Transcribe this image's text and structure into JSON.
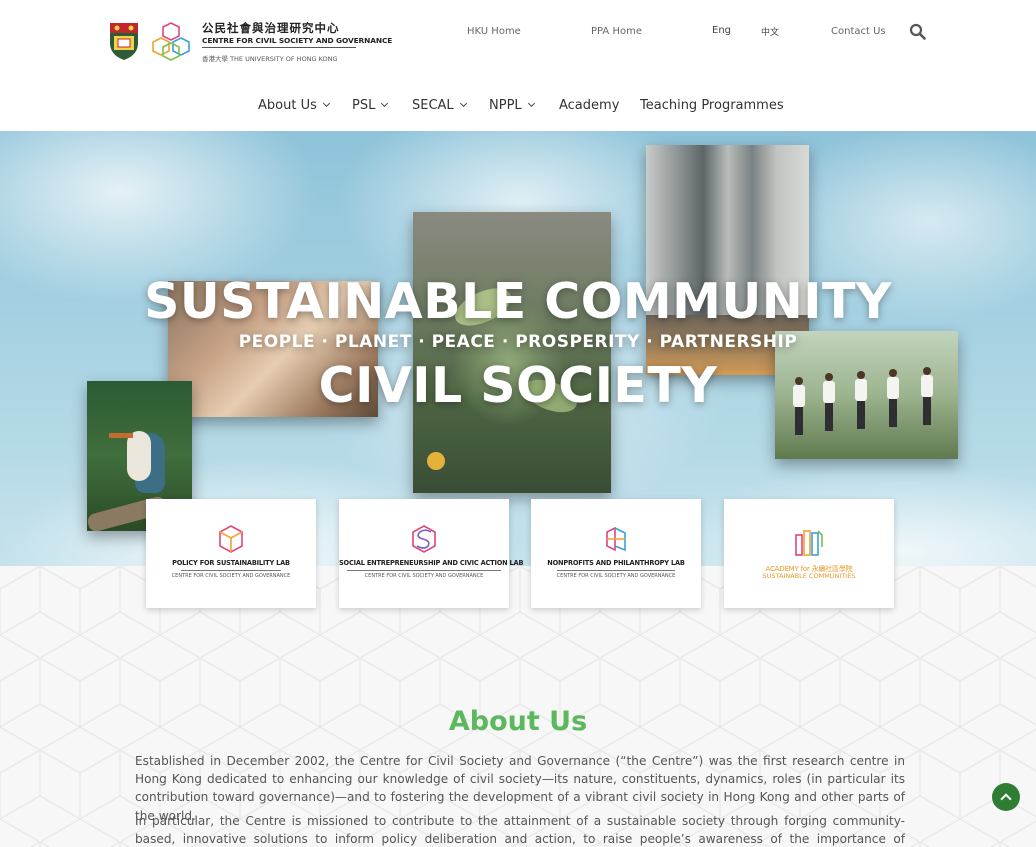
{
  "header": {
    "logo": {
      "name_cn": "公民社會與治理研究中心",
      "name_en": "CENTRE FOR CIVIL SOCIETY AND GOVERNANCE",
      "university": "香港大學 THE UNIVERSITY OF HONG KONG"
    },
    "top_links": {
      "hku_home": "HKU Home",
      "ppa_home": "PPA Home",
      "eng": "Eng",
      "chinese": "中文",
      "contact": "Contact Us"
    },
    "nav": {
      "about": "About Us",
      "psl": "PSL",
      "secal": "SECAL",
      "nppl": "NPPL",
      "academy": "Academy",
      "teaching": "Teaching Programmes"
    }
  },
  "hero": {
    "line1": "SUSTAINABLE COMMUNITY",
    "line2": "PEOPLE · PLANET · PEACE · PROSPERITY · PARTNERSHIP",
    "line3": "CIVIL SOCIETY"
  },
  "labs": [
    {
      "name": "POLICY FOR SUSTAINABILITY LAB",
      "sub": "CENTRE FOR CIVIL SOCIETY AND GOVERNANCE"
    },
    {
      "name": "SOCIAL ENTREPRENEURSHIP AND CIVIC ACTION LAB",
      "sub": "CENTRE FOR CIVIL SOCIETY AND GOVERNANCE"
    },
    {
      "name": "NONPROFITS AND PHILANTHROPY LAB",
      "sub": "CENTRE FOR CIVIL SOCIETY AND GOVERNANCE"
    },
    {
      "name": "ACADEMY for 永續社區學院",
      "sub": "SUSTAINABLE COMMUNITIES"
    }
  ],
  "about": {
    "title": "About Us",
    "p1": "Established in December 2002, the Centre for Civil Society and Governance (“the Centre”) was the first research centre in Hong Kong dedicated to enhancing our knowledge of civil society—its nature, constituents, dynamics, roles (in particular its contribution toward governance)—and to fostering the development of a vibrant civil society in Hong Kong and other parts of the world.",
    "p2": "In particular, the Centre is missioned to contribute to the attainment of a sustainable society through forging community-based, innovative solutions to inform policy deliberation and action, to raise people’s awareness of the importance of sustainability, to facilitate"
  },
  "colors": {
    "accent_green": "#5cb85c",
    "back_to_top": "#2e7d32",
    "academy_orange": "#e89a2a"
  },
  "icons": [
    "search-icon",
    "chevron-down-icon",
    "chevron-up-icon"
  ]
}
